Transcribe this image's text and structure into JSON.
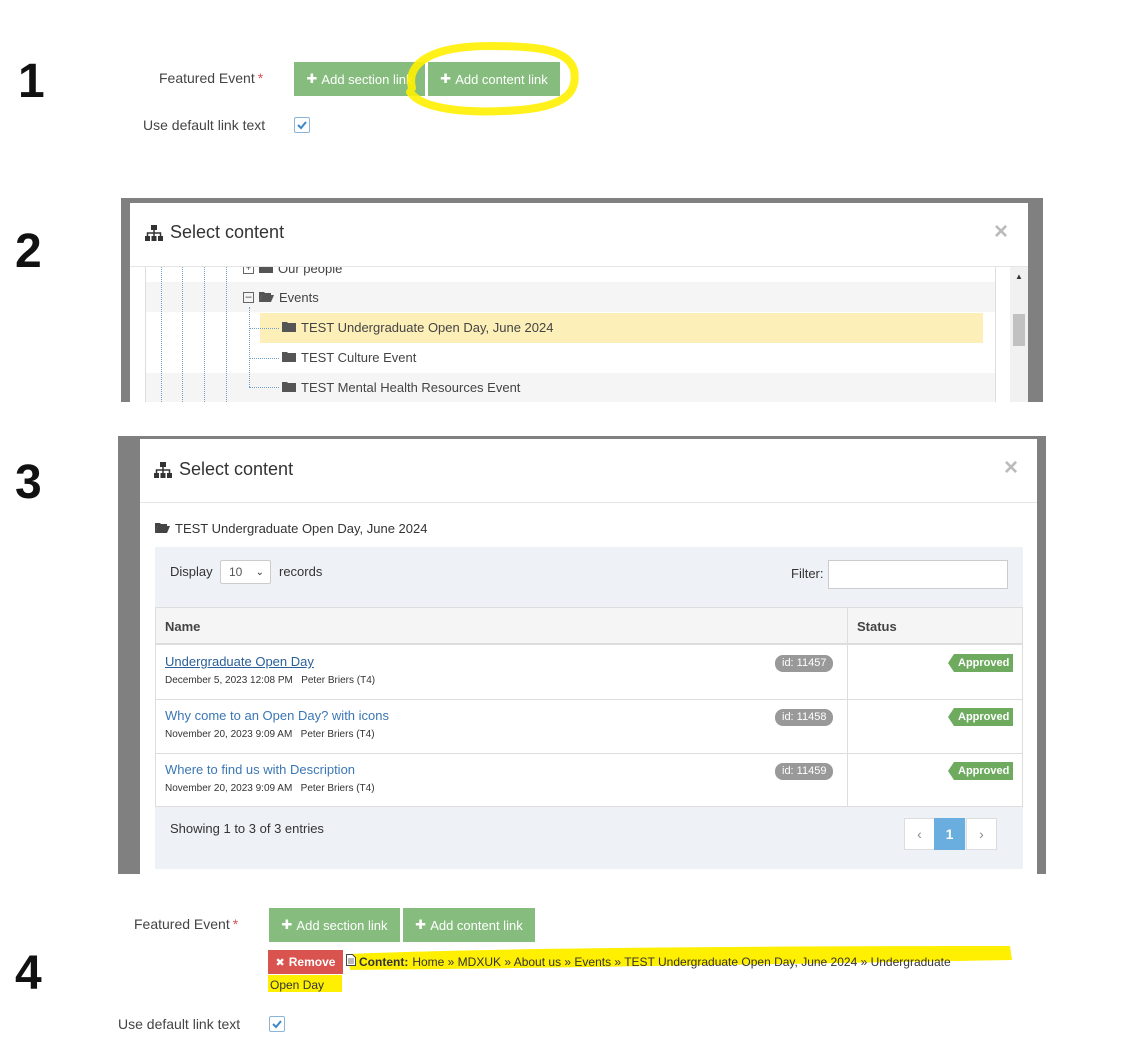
{
  "steps": [
    "1",
    "2",
    "3",
    "4"
  ],
  "form": {
    "featured_event_label": "Featured Event",
    "required_mark": "*",
    "add_section_link": "Add section link",
    "add_content_link": "Add content link",
    "use_default_link_text": "Use default link text",
    "use_default_checked": true
  },
  "modal": {
    "title": "Select content",
    "close": "×"
  },
  "tree": {
    "items": [
      {
        "label": "Our people"
      },
      {
        "label": "Events"
      },
      {
        "label": "TEST Undergraduate Open Day, June 2024",
        "selected": true
      },
      {
        "label": "TEST Culture Event"
      },
      {
        "label": "TEST Mental Health Resources Event"
      }
    ]
  },
  "content_list": {
    "folder_title": "TEST Undergraduate Open Day, June 2024",
    "display_label": "Display",
    "display_value": "10",
    "records_label": "records",
    "filter_label": "Filter:",
    "filter_value": "",
    "columns": [
      "Name",
      "Status"
    ],
    "rows": [
      {
        "name": "Undergraduate Open Day",
        "date": "December 5, 2023 12:08 PM",
        "author": "Peter Briers (T4)",
        "id": "id: 11457",
        "status": "Approved"
      },
      {
        "name": "Why come to an Open Day? with icons",
        "date": "November 20, 2023 9:09 AM",
        "author": "Peter Briers (T4)",
        "id": "id: 11458",
        "status": "Approved"
      },
      {
        "name": "Where to find us with Description",
        "date": "November 20, 2023 9:09 AM",
        "author": "Peter Briers (T4)",
        "id": "id: 11459",
        "status": "Approved"
      }
    ],
    "summary": "Showing 1 to 3 of 3 entries",
    "pager": {
      "prev": "‹",
      "current": "1",
      "next": "›"
    }
  },
  "result": {
    "remove_label": "Remove",
    "content_prefix": "Content:",
    "breadcrumb_line1": "Home » MDXUK » About us » Events » TEST Undergraduate Open Day, June 2024 » Undergraduate",
    "breadcrumb_line2": "Open Day"
  },
  "colors": {
    "green_button": "#86bd7e",
    "highlight": "#ffef00",
    "remove_red": "#d9534f",
    "approved": "#6eab5f",
    "selected_row": "#fdefb8",
    "pager_active": "#6aaee0"
  }
}
